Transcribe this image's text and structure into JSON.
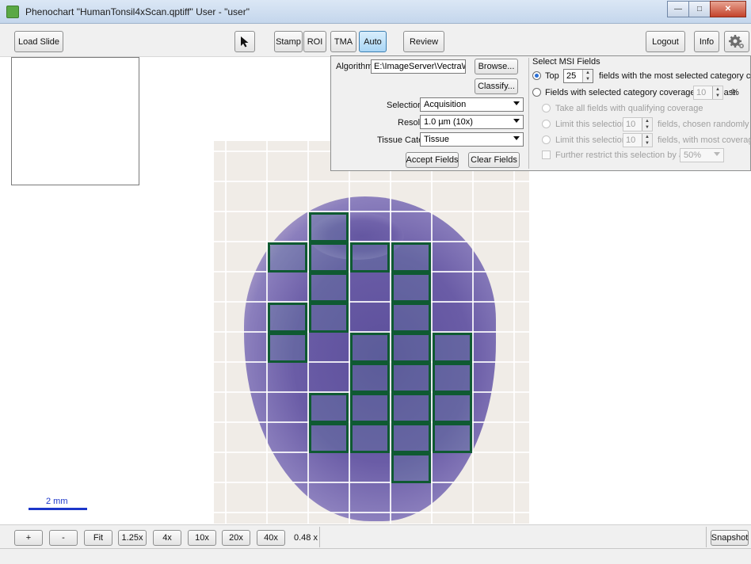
{
  "window": {
    "title": "Phenochart \"HumanTonsil4xScan.qptiff\"  User - \"user\""
  },
  "toolbar": {
    "load_slide": "Load Slide",
    "stamp": "Stamp",
    "roi": "ROI",
    "tma": "TMA",
    "auto": "Auto",
    "review": "Review",
    "logout": "Logout",
    "info": "Info"
  },
  "auto_panel": {
    "algorithm_label": "Algorithm:",
    "algorithm_value": "E:\\ImageServer\\VectraWS\\",
    "browse": "Browse...",
    "classify": "Classify...",
    "selection_type_label": "Selection Type:",
    "selection_type_value": "Acquisition",
    "resolution_label": "Resolution:",
    "resolution_value": "1.0 µm (10x)",
    "tissue_category_label": "Tissue Category:",
    "tissue_category_value": "Tissue",
    "accept_fields": "Accept Fields",
    "clear_fields": "Clear Fields",
    "msi_header": "Select MSI Fields",
    "top_label": "Top",
    "top_value": "25",
    "top_suffix": "fields with the most selected category coverage",
    "coverage_label": "Fields with selected category coverage of at least",
    "coverage_value": "10",
    "coverage_unit": "%",
    "take_all": "Take all fields with qualifying coverage",
    "limit_label_1": "Limit this selection to",
    "limit_value_1": "10",
    "limit_suffix_1": "fields, chosen randomly",
    "limit_label_2": "Limit this selection to",
    "limit_value_2": "10",
    "limit_suffix_2": "fields, with most coverage",
    "grid_label": "Further restrict this selection by a grid of",
    "grid_value": "50%"
  },
  "scale": {
    "label": "2 mm"
  },
  "zoom": {
    "plus": "+",
    "minus": "-",
    "fit": "Fit",
    "z125": "1.25x",
    "z4": "4x",
    "z10": "10x",
    "z20": "20x",
    "z40": "40x",
    "current": "0.48 x",
    "snapshot": "Snapshot"
  },
  "colors": {
    "field_border": "#0f5a32",
    "scale_bar": "#1c36c9",
    "active_button": "#a9d6f5"
  }
}
